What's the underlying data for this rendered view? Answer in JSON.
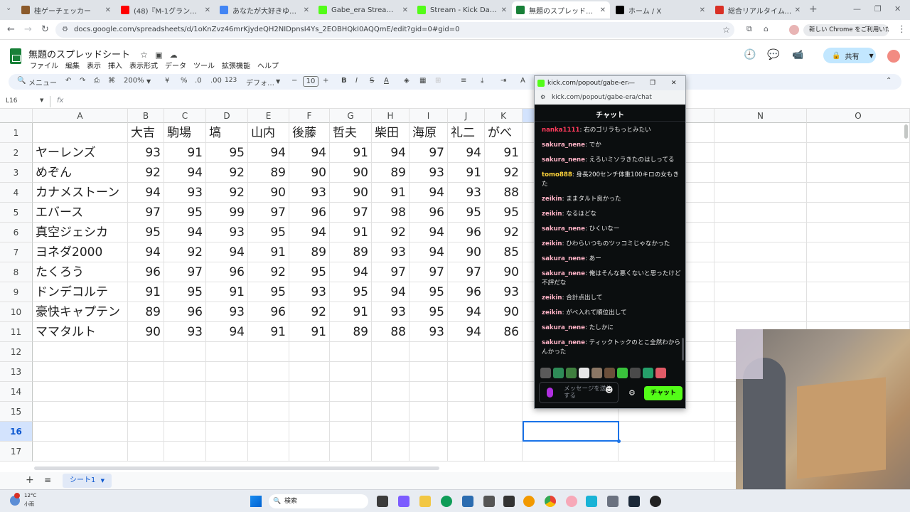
{
  "browser": {
    "tabs": [
      {
        "title": "桂ゲーチェッカー",
        "favcolor": "#8b5a2b"
      },
      {
        "title": "(48)『M-1グランプリは審がな…",
        "favcolor": "#ff0000"
      },
      {
        "title": "あなたが大好きゆかりちゃん…",
        "favcolor": "#4285f4"
      },
      {
        "title": "Gabe_era Stream - Watch…",
        "favcolor": "#53fc18"
      },
      {
        "title": "Stream - Kick Dashboard",
        "favcolor": "#53fc18"
      },
      {
        "title": "無題のスプレッドシート - Goo…",
        "favcolor": "#188038"
      },
      {
        "title": "ホーム / X",
        "favcolor": "#000000"
      },
      {
        "title": "総合リアルタイムランキング |…",
        "favcolor": "#d93025"
      }
    ],
    "url": "docs.google.com/spreadsheets/d/1oKnZvz46mrKjydeQH2NIDpnsI4Ys_2EOBHQkI0AQQmE/edit?gid=0#gid=0",
    "update_notice": "新しい Chrome をご利用いただけます"
  },
  "sheets": {
    "doc_title": "無題のスプレッドシート",
    "menu": [
      "ファイル",
      "編集",
      "表示",
      "挿入",
      "表示形式",
      "データ",
      "ツール",
      "拡張機能",
      "ヘルプ"
    ],
    "share_label": "共有",
    "toolbar": {
      "menu_search": "メニュー",
      "zoom": "200%",
      "currency": "¥",
      "percent": "%",
      "dec_less": ".0",
      "dec_more": ".00",
      "format_123": "123",
      "font": "デフォ…",
      "font_size": "10"
    },
    "name_box": "L16",
    "fx": "fx",
    "columns": [
      "A",
      "B",
      "C",
      "D",
      "E",
      "F",
      "G",
      "H",
      "I",
      "J",
      "K",
      "L",
      "M",
      "N",
      "O"
    ],
    "rows": [
      [
        "",
        "大吉",
        "駒場",
        "塙",
        "山内",
        "後藤",
        "哲夫",
        "柴田",
        "海原",
        "礼二",
        "がべ"
      ],
      [
        "ヤーレンズ",
        "93",
        "91",
        "95",
        "94",
        "94",
        "91",
        "94",
        "97",
        "94",
        "91"
      ],
      [
        "めぞん",
        "92",
        "94",
        "92",
        "89",
        "90",
        "90",
        "89",
        "93",
        "91",
        "92"
      ],
      [
        "カナメストーン",
        "94",
        "93",
        "92",
        "90",
        "93",
        "90",
        "91",
        "94",
        "93",
        "88"
      ],
      [
        "エバース",
        "97",
        "95",
        "99",
        "97",
        "96",
        "97",
        "98",
        "96",
        "95",
        "95"
      ],
      [
        "真空ジェシカ",
        "95",
        "94",
        "93",
        "95",
        "94",
        "91",
        "92",
        "94",
        "96",
        "92"
      ],
      [
        "ヨネダ2000",
        "94",
        "92",
        "94",
        "91",
        "89",
        "89",
        "93",
        "94",
        "90",
        "85"
      ],
      [
        "たくろう",
        "96",
        "97",
        "96",
        "92",
        "95",
        "94",
        "97",
        "97",
        "97",
        "90"
      ],
      [
        "ドンデコルテ",
        "91",
        "95",
        "91",
        "95",
        "93",
        "95",
        "94",
        "95",
        "96",
        "93"
      ],
      [
        "豪快キャプテン",
        "89",
        "96",
        "93",
        "96",
        "92",
        "91",
        "93",
        "95",
        "94",
        "90"
      ],
      [
        "ママタルト",
        "90",
        "93",
        "94",
        "91",
        "91",
        "89",
        "88",
        "93",
        "94",
        "86"
      ]
    ],
    "row_numbers": [
      "1",
      "2",
      "3",
      "4",
      "5",
      "6",
      "7",
      "8",
      "9",
      "10",
      "11",
      "12",
      "13",
      "14",
      "15",
      "16",
      "17"
    ],
    "sheet_tab": "シート1"
  },
  "popout": {
    "window_title": "kick.com/popout/gabe-era/chat - Go…",
    "url": "kick.com/popout/gabe-era/chat",
    "chat_header": "チャット",
    "messages": [
      {
        "user": "nanka1111",
        "text": "右のゴリラもっとみたい",
        "color": "#ff3b5c"
      },
      {
        "user": "sakura_nene",
        "text": "でか",
        "color": "#ffb3c6"
      },
      {
        "user": "sakura_nene",
        "text": "えろいミソラきたのはしってる",
        "color": "#ffb3c6"
      },
      {
        "user": "tomo888",
        "text": "身長200センチ体重100キロの女もきた",
        "color": "#ffd43b"
      },
      {
        "user": "zeikin",
        "text": "ままタルト良かった",
        "color": "#ffb3c6"
      },
      {
        "user": "zeikin",
        "text": "なるほどな",
        "color": "#ffb3c6"
      },
      {
        "user": "sakura_nene",
        "text": "ひくいなー",
        "color": "#ffb3c6"
      },
      {
        "user": "zeikin",
        "text": "ひわらいつものツッコミじゃなかった",
        "color": "#ffb3c6"
      },
      {
        "user": "sakura_nene",
        "text": "あー",
        "color": "#ffb3c6"
      },
      {
        "user": "sakura_nene",
        "text": "俺はそんな悪くないと思ったけど不評だな",
        "color": "#ffb3c6"
      },
      {
        "user": "zeikin",
        "text": "合計点出して",
        "color": "#ffb3c6"
      },
      {
        "user": "zeikin",
        "text": "がべ入れて順位出して",
        "color": "#ffb3c6"
      },
      {
        "user": "sakura_nene",
        "text": "たしかに",
        "color": "#ffb3c6"
      },
      {
        "user": "sakura_nene",
        "text": "ティックトックのとこ全然わからんかった",
        "color": "#ffb3c6"
      }
    ],
    "input_placeholder": "メッセージを送信する",
    "send_label": "チャット"
  },
  "taskbar": {
    "weather_temp": "12°C",
    "weather_desc": "小雨",
    "search_label": "検索"
  }
}
